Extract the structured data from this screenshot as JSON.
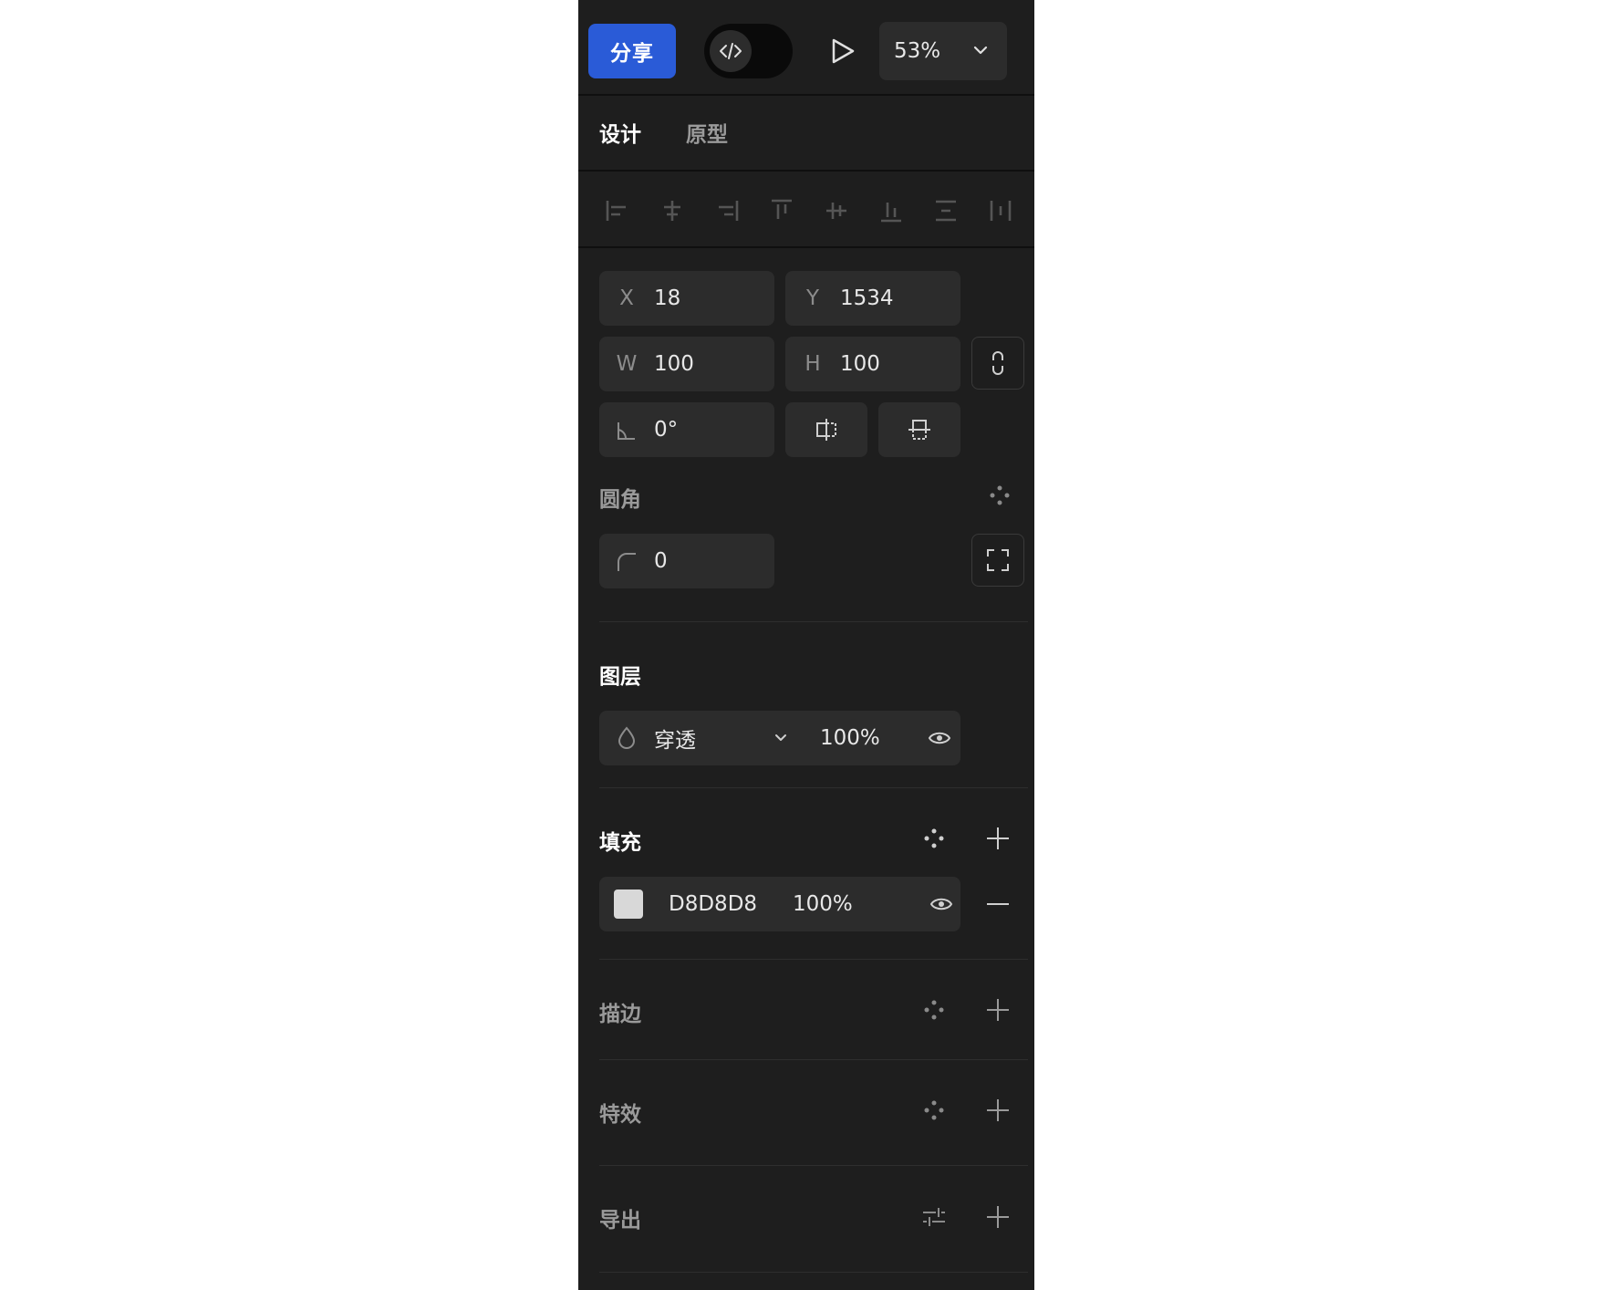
{
  "toolbar": {
    "share_label": "分享",
    "zoom": "53%"
  },
  "tabs": {
    "design": "设计",
    "prototype": "原型"
  },
  "transform": {
    "x_label": "X",
    "x": "18",
    "y_label": "Y",
    "y": "1534",
    "w_label": "W",
    "w": "100",
    "h_label": "H",
    "h": "100",
    "rotation": "0°"
  },
  "corner": {
    "title": "圆角",
    "radius": "0"
  },
  "layer": {
    "title": "图层",
    "blend_mode": "穿透",
    "opacity": "100%"
  },
  "fill": {
    "title": "填充",
    "color_hex": "D8D8D8",
    "swatch": "#D8D8D8",
    "opacity": "100%"
  },
  "stroke": {
    "title": "描边"
  },
  "effects": {
    "title": "特效"
  },
  "export": {
    "title": "导出"
  },
  "colors": {
    "panel_bg": "#1e1e1e",
    "field_bg": "#2c2c2c",
    "accent": "#2a5bd7"
  }
}
